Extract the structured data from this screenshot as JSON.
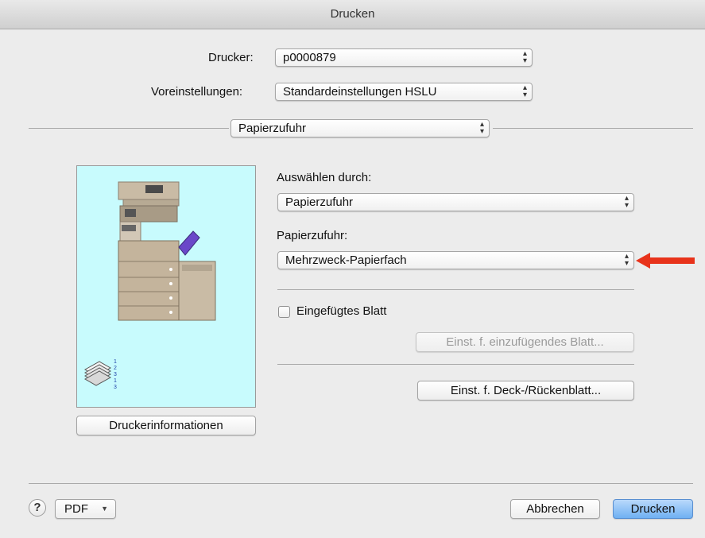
{
  "window": {
    "title": "Drucken"
  },
  "printer": {
    "label": "Drucker:",
    "value": "p0000879"
  },
  "presets": {
    "label": "Voreinstellungen:",
    "value": "Standardeinstellungen HSLU"
  },
  "section": {
    "value": "Papierzufuhr"
  },
  "select_by": {
    "label": "Auswählen durch:",
    "value": "Papierzufuhr"
  },
  "paper_source": {
    "label": "Papierzufuhr:",
    "value": "Mehrzweck-Papierfach"
  },
  "inserted_sheet": {
    "label": "Eingefügtes Blatt",
    "checked": false,
    "settings_button": "Einst. f. einzufügendes Blatt..."
  },
  "cover_button": "Einst. f. Deck-/Rückenblatt...",
  "printer_info_button": "Druckerinformationen",
  "footer": {
    "help": "?",
    "pdf_label": "PDF",
    "pdf_arrow": "▼",
    "cancel": "Abbrechen",
    "print": "Drucken"
  },
  "colors": {
    "preview_bg": "#c8fbfd",
    "annotation_arrow": "#e8331b",
    "primary_button": "#6fb0f2"
  },
  "popup_arrows": "▴▾"
}
